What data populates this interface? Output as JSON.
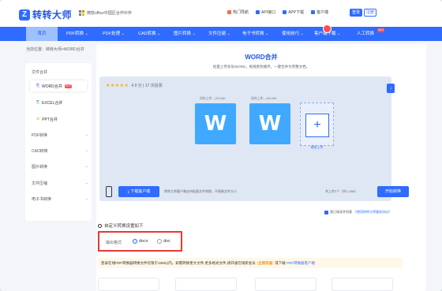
{
  "brand": {
    "logo_letter": "Z",
    "name": "转转大师",
    "partner": "微软office中国区合作伙伴",
    "ms_colors": [
      "#f25022",
      "#7fba00",
      "#00a4ef",
      "#ffb900"
    ]
  },
  "top_links": [
    "热门导航",
    "API接口",
    "APP下载",
    "客户端"
  ],
  "auth": {
    "login": "登录",
    "register": "注册"
  },
  "nav": {
    "home": "首页",
    "items": [
      "PDF转换",
      "PDF处理",
      "CAD转换",
      "图片转换",
      "文件压缩",
      "电子书转换",
      "使用技巧",
      "客户端下载",
      "人工转换"
    ],
    "hot": "HOT"
  },
  "breadcrumb": "当前位置：转转大师>WORD合并",
  "sidebar": {
    "group": "文件合并",
    "subs": [
      {
        "label": "WORD合并",
        "hot": "HOT",
        "color": "#2f6bff"
      },
      {
        "label": "EXCEL合并",
        "color": "#27ae60"
      },
      {
        "label": "PPT合并",
        "color": "#f39c12"
      }
    ],
    "groups": [
      "PDF转换",
      "CAD转换",
      "图片转换",
      "文件压缩",
      "电子书转换"
    ]
  },
  "main": {
    "title": "WORD合并",
    "subtitle": "批量上传多份WORD，拖拽更改顺序，一键合并为完整文档。",
    "rating_stars": "★★★★★",
    "rating_text": "4.9 分 | 17 次投票",
    "files": [
      {
        "name": "如何上传...",
        "size": "(93.34K"
      },
      {
        "name": "如何上传...",
        "size": "(93.28K"
      }
    ],
    "file_letter": "W",
    "plus": "+",
    "continue": "继续上传",
    "download_client": "下载客户端",
    "tip": "转转大师客户端支持批量文件转换，不限制文件大小",
    "count": "共上传2个（共1.23M）",
    "start": "开始转换",
    "agree_prefix": "我已阅读并同意",
    "agree_link": "《使用转转大师服务协议》",
    "custom": "自定义转换设置如下",
    "format_label": "输出格式",
    "format_options": [
      "docx",
      "doc"
    ],
    "format_selected": "docx",
    "notice": "登录在线PDF转换器转换文件仅限于15M以内。如需转换更大文件,更多格式文件,请开通在线新会员",
    "vip": "立即开通",
    "notice_or": "或下载",
    "notice_link": "PDF转换器客户端"
  }
}
